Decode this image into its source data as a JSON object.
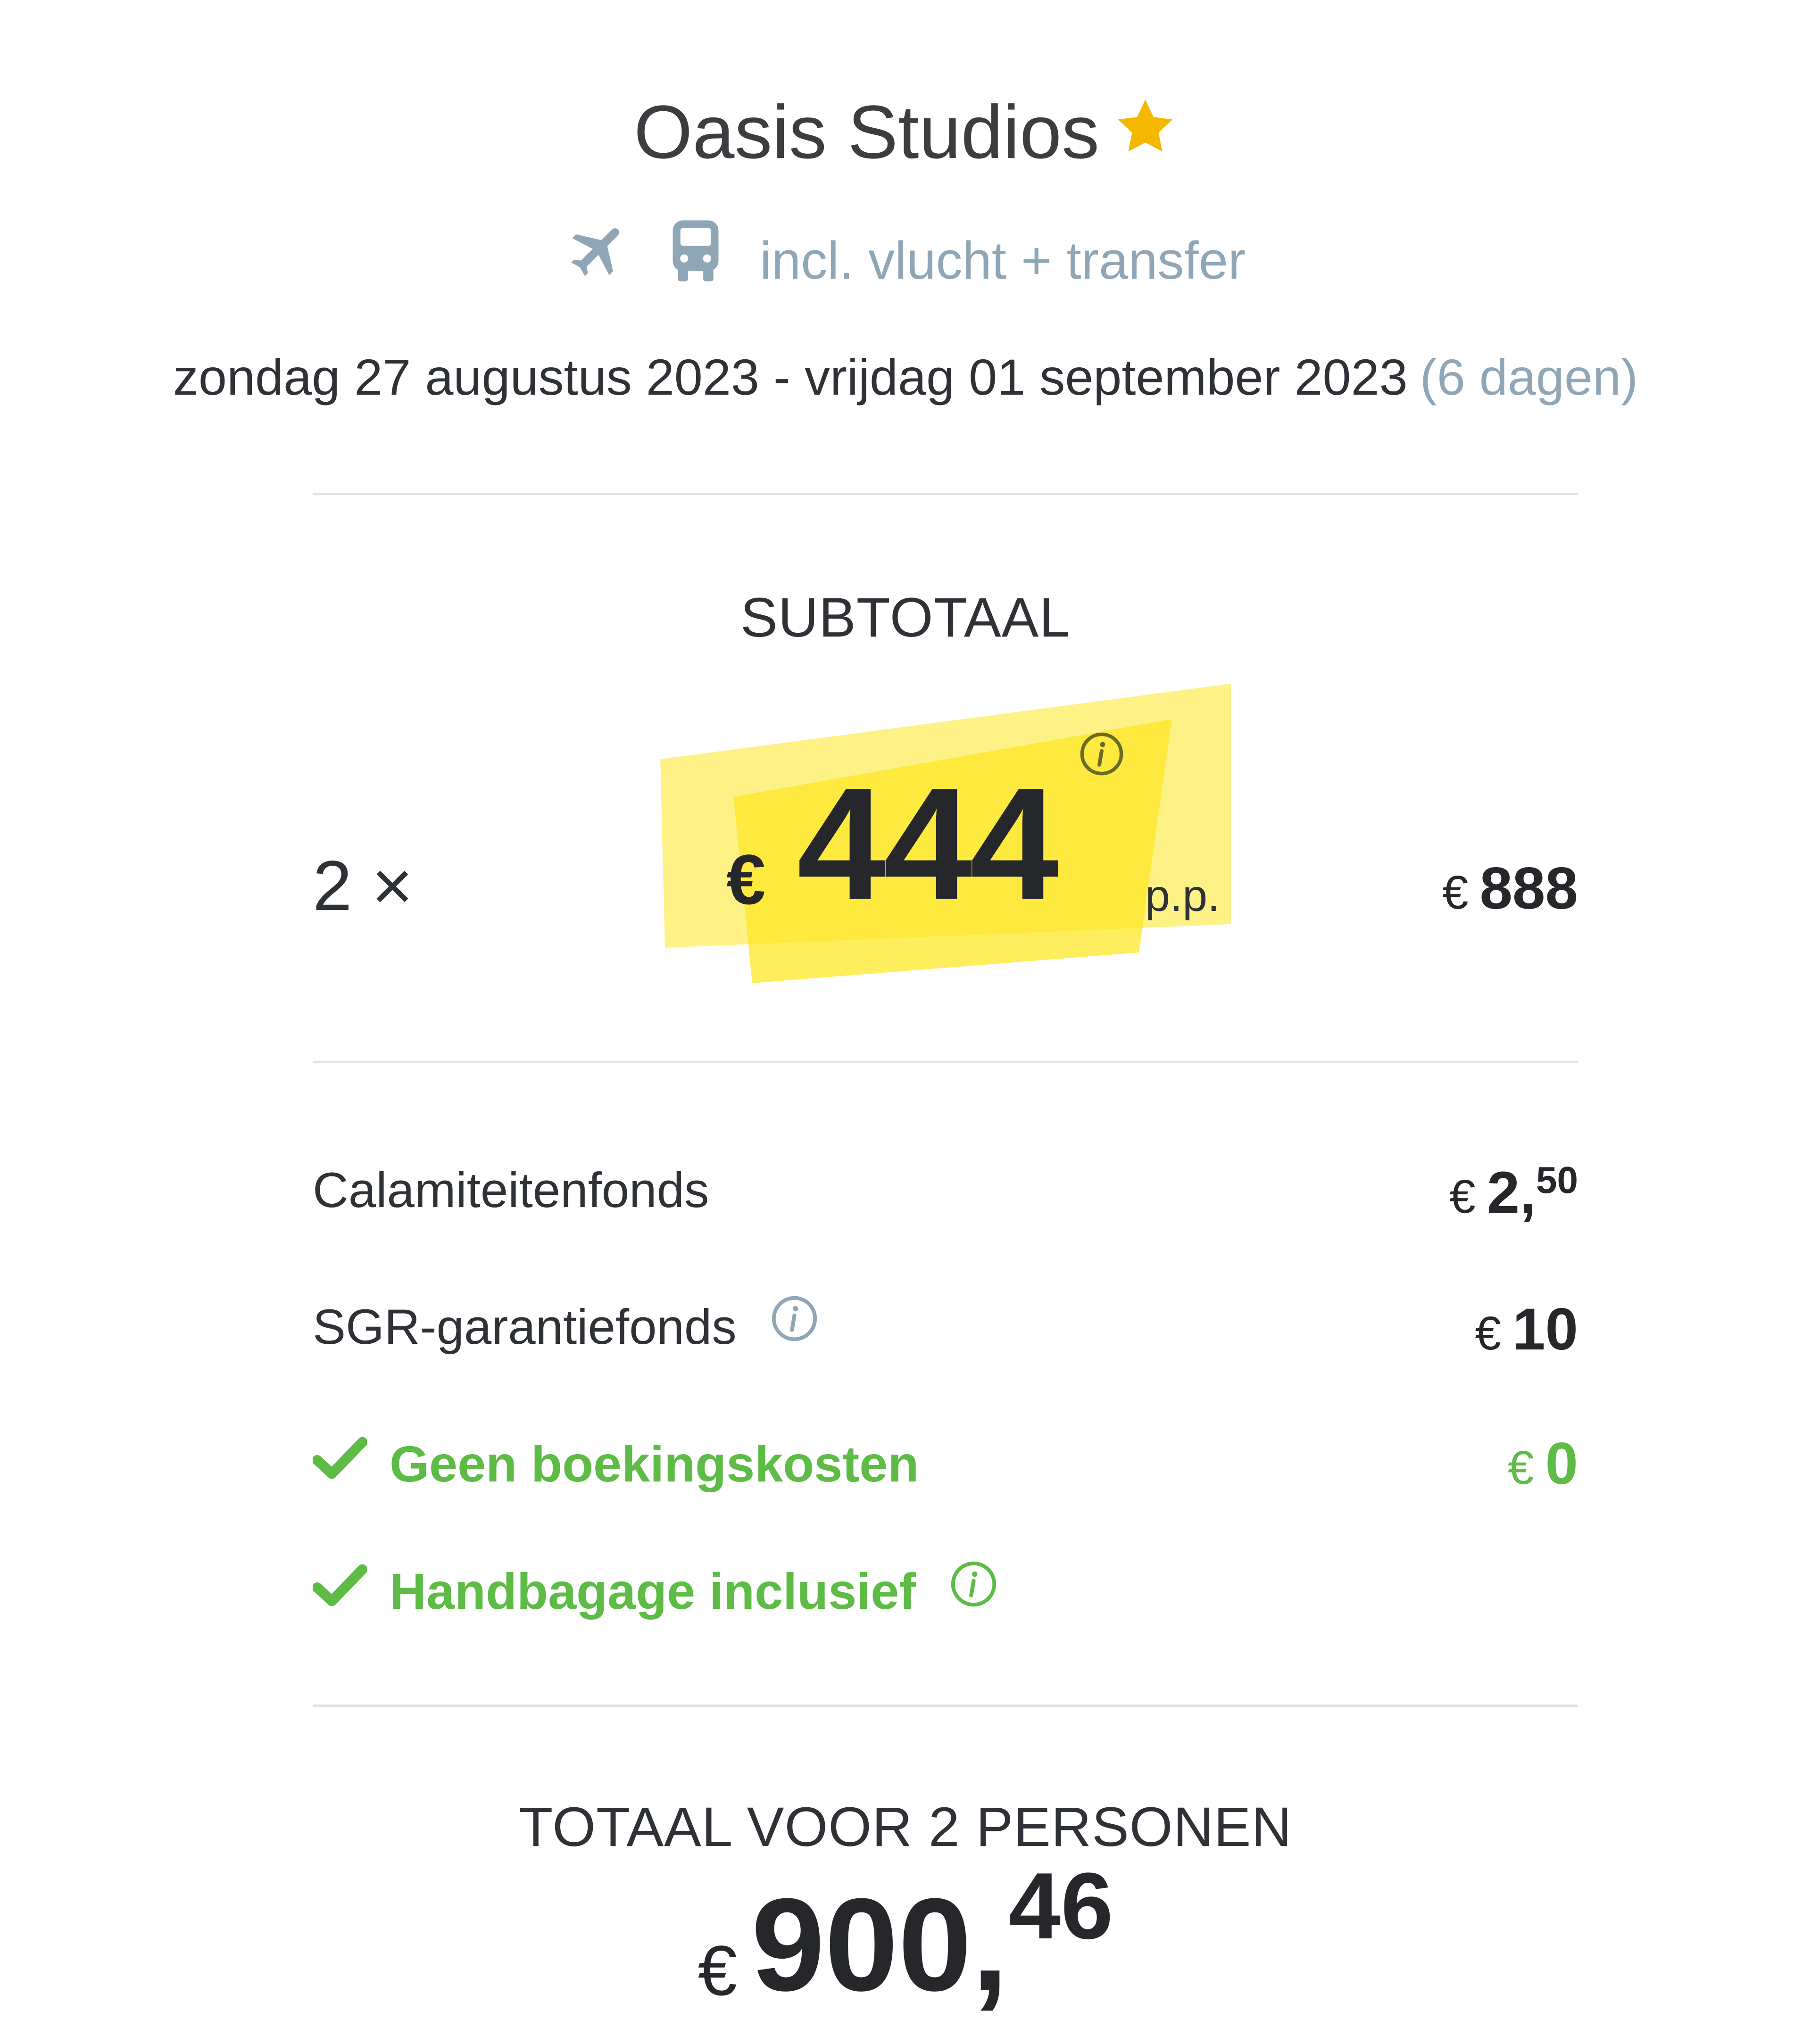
{
  "header": {
    "title": "Oasis Studios",
    "transport_text": "incl. vlucht + transfer",
    "dates": "zondag 27 augustus 2023 - vrijdag 01 september 2023",
    "duration": "(6 dagen)"
  },
  "subtotal": {
    "title": "SUBTOTAAL",
    "quantity": "2 ×",
    "currency": "€",
    "price_per_person": "444",
    "pp_label": "p.p.",
    "row_total": "888"
  },
  "costs": [
    {
      "label": "Calamiteitenfonds",
      "currency": "€",
      "amount": "2,",
      "decimals": "50"
    },
    {
      "label": "SGR-garantiefonds",
      "currency": "€",
      "amount": "10"
    },
    {
      "label": "Geen boekingskosten",
      "currency": "€",
      "amount": "0"
    },
    {
      "label": "Handbagage inclusief"
    }
  ],
  "total": {
    "title": "TOTAAL VOOR 2 PERSONEN",
    "currency": "€",
    "amount": "900,",
    "decimals": "46"
  },
  "colors": {
    "highlight": "#fde725",
    "green": "#5dbb46",
    "muted": "#8fa6b7",
    "star": "#f5b700"
  },
  "icons": [
    "star-icon",
    "airplane-icon",
    "bus-icon",
    "info-icon",
    "check-icon"
  ]
}
